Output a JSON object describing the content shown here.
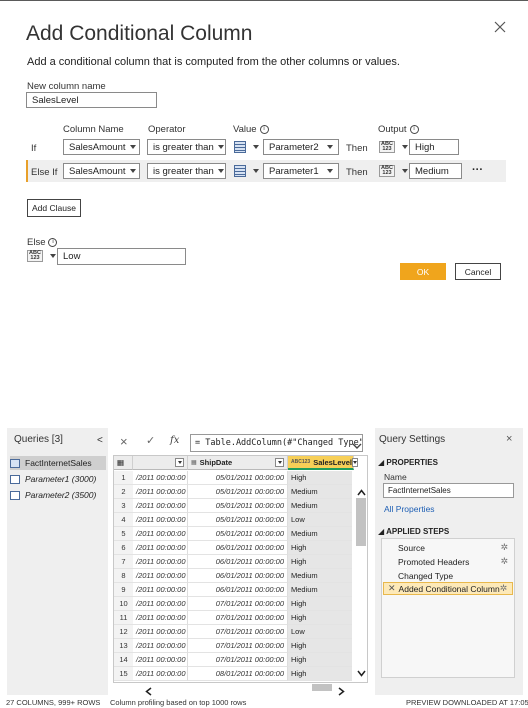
{
  "dialog": {
    "title": "Add Conditional Column",
    "description": "Add a conditional column that is computed from the other columns or values.",
    "new_column_label": "New column name",
    "new_column_value": "SalesLevel",
    "headers": {
      "column_name": "Column Name",
      "operator": "Operator",
      "value": "Value",
      "output": "Output"
    },
    "clauses": [
      {
        "keyword": "If",
        "column": "SalesAmount",
        "operator": "is greater than",
        "value": "Parameter2",
        "then": "Then",
        "output": "High"
      },
      {
        "keyword": "Else If",
        "column": "SalesAmount",
        "operator": "is greater than",
        "value": "Parameter1",
        "then": "Then",
        "output": "Medium"
      }
    ],
    "more_label": "···",
    "add_clause": "Add Clause",
    "else_label": "Else",
    "else_value": "Low",
    "type_badge_top": "ABC",
    "type_badge_bottom": "123",
    "ok": "OK",
    "cancel": "Cancel",
    "info_glyph": "i",
    "close_icon": "close-icon"
  },
  "queries": {
    "title": "Queries [3]",
    "collapse_glyph": "<",
    "items": [
      "FactInternetSales",
      "Parameter1 (3000)",
      "Parameter2 (3500)"
    ]
  },
  "formula_bar": {
    "cancel_glyph": "×",
    "commit_glyph": "✓",
    "fx": "fx",
    "formula": "= Table.AddColumn(#\"Changed Type\", ",
    "expand_glyph": "⌄"
  },
  "grid": {
    "corner_glyph": "▦",
    "columns": [
      "",
      "ShipDate",
      "SalesLevel"
    ],
    "column_type_badge": "ABC123",
    "rows": [
      [
        "1",
        "/2011 00:00:00",
        "05/01/2011 00:00:00",
        "High"
      ],
      [
        "2",
        "/2011 00:00:00",
        "05/01/2011 00:00:00",
        "Medium"
      ],
      [
        "3",
        "/2011 00:00:00",
        "05/01/2011 00:00:00",
        "Medium"
      ],
      [
        "4",
        "/2011 00:00:00",
        "05/01/2011 00:00:00",
        "Low"
      ],
      [
        "5",
        "/2011 00:00:00",
        "05/01/2011 00:00:00",
        "Medium"
      ],
      [
        "6",
        "/2011 00:00:00",
        "06/01/2011 00:00:00",
        "High"
      ],
      [
        "7",
        "/2011 00:00:00",
        "06/01/2011 00:00:00",
        "High"
      ],
      [
        "8",
        "/2011 00:00:00",
        "06/01/2011 00:00:00",
        "Medium"
      ],
      [
        "9",
        "/2011 00:00:00",
        "06/01/2011 00:00:00",
        "Medium"
      ],
      [
        "10",
        "/2011 00:00:00",
        "07/01/2011 00:00:00",
        "High"
      ],
      [
        "11",
        "/2011 00:00:00",
        "07/01/2011 00:00:00",
        "High"
      ],
      [
        "12",
        "/2011 00:00:00",
        "07/01/2011 00:00:00",
        "Low"
      ],
      [
        "13",
        "/2011 00:00:00",
        "07/01/2011 00:00:00",
        "High"
      ],
      [
        "14",
        "/2011 00:00:00",
        "07/01/2011 00:00:00",
        "High"
      ],
      [
        "15",
        "/2011 00:00:00",
        "08/01/2011 00:00:00",
        "High"
      ]
    ],
    "scroll_up": "^",
    "scroll_down": "v",
    "scroll_left": "<",
    "scroll_right": ">"
  },
  "settings": {
    "title": "Query Settings",
    "close_glyph": "×",
    "properties_header": "◢ PROPERTIES",
    "name_label": "Name",
    "name_value": "FactInternetSales",
    "all_properties": "All Properties",
    "steps_header": "◢ APPLIED STEPS",
    "steps": [
      "Source",
      "Promoted Headers",
      "Changed Type",
      "Added Conditional Column"
    ],
    "gear_glyph": "✲",
    "remove_glyph": "✕"
  },
  "status": {
    "left": "27 COLUMNS, 999+ ROWS",
    "middle": "Column profiling based on top 1000 rows",
    "right": "PREVIEW DOWNLOADED AT 17:05"
  },
  "colors": {
    "accent": "#f0a51c",
    "selected_column": "#f7cf57",
    "link": "#1e5fb4"
  }
}
